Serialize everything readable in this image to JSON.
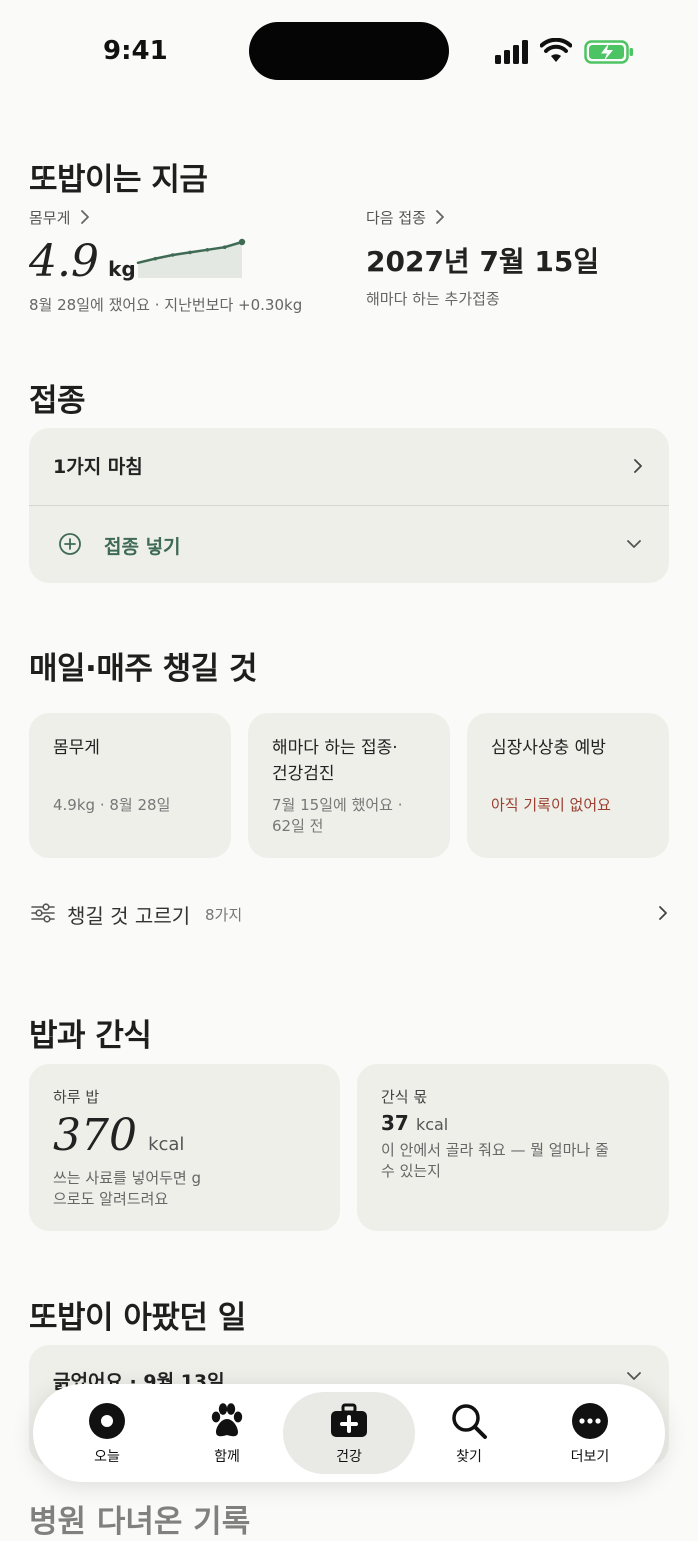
{
  "status_bar": {
    "time": "9:41"
  },
  "now": {
    "title": "또밥이는 지금",
    "weight": {
      "label": "몸무게",
      "value": "4.9",
      "unit": "kg",
      "note": "8월 28일에 쟀어요 · 지난번보다 +0.30kg",
      "trend_kg": [
        4.5,
        4.58,
        4.65,
        4.7,
        4.75,
        4.8,
        4.9
      ]
    },
    "next_vaccine": {
      "label": "다음 접종",
      "date": "2027년 7월 15일",
      "note": "해마다 하는 추가접종"
    }
  },
  "vaccination": {
    "title": "접종",
    "done_label": "1가지 마침",
    "add_label": "접종 넣기"
  },
  "routine": {
    "title": "매일·매주 챙길 것",
    "cards": [
      {
        "title": "몸무게",
        "sub": "4.9kg · 8월 28일"
      },
      {
        "title": "해마다 하는 접종·\n건강검진",
        "sub": "7월 15일에 했어요 ·\n62일 전"
      },
      {
        "title": "심장사상충 예방",
        "sub": "아직 기록이 없어요"
      }
    ],
    "pick_label": "챙길 것 고르기",
    "pick_count": "8가지"
  },
  "food": {
    "title": "밥과 간식",
    "daily": {
      "label": "하루 밥",
      "value": "370",
      "unit": "kcal",
      "note": "쓰는 사료를 넣어두면 g\n으로도 알려드려요"
    },
    "snack": {
      "label": "간식 몫",
      "value": "37",
      "unit": "kcal",
      "note": "이 안에서 골라 줘요 — 뭘 얼마나 줄\n수 있는지"
    }
  },
  "sick": {
    "title": "또밥이 아팠던 일",
    "row_label": "긁었어요 · 9월 13일"
  },
  "next_section_peek": "병원 다녀온 기록",
  "nav": [
    {
      "label": "오늘",
      "icon": "today-icon"
    },
    {
      "label": "함께",
      "icon": "paw-icon"
    },
    {
      "label": "건강",
      "icon": "medical-kit-icon",
      "active": true
    },
    {
      "label": "찾기",
      "icon": "search-icon"
    },
    {
      "label": "더보기",
      "icon": "more-icon"
    }
  ],
  "colors": {
    "accent_green": "#3f6b55",
    "warning_red": "#9a4030",
    "card_bg": "#efefea",
    "background": "#fafaf8"
  }
}
